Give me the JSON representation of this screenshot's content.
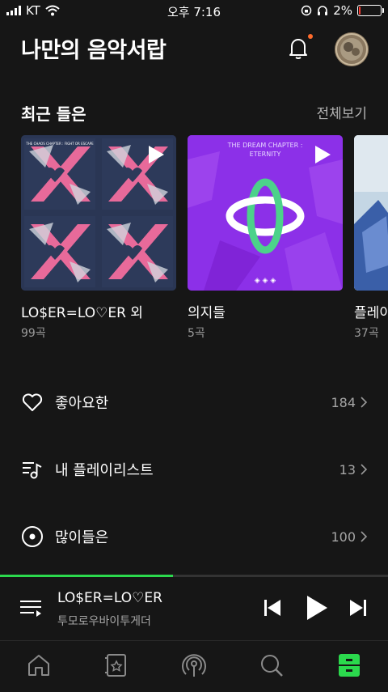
{
  "status": {
    "carrier": "KT",
    "time": "오후 7:16",
    "battery": "2%",
    "battery_level": 0.02
  },
  "header": {
    "title": "나만의 음악서랍",
    "bell_icon": "bell-icon",
    "avatar": "profile-avatar"
  },
  "recent": {
    "title": "최근 들은",
    "see_all": "전체보기",
    "cards": [
      {
        "title": "LO$ER=LO♡ER 외",
        "sub": "99곡",
        "cover_text": "THE CHAOS CHAPTER : FIGHT OR ESCAPE"
      },
      {
        "title": "의지들",
        "sub": "5곡",
        "cover_text_1": "THE DREAM CHAPTER :",
        "cover_text_2": "ETERNITY"
      },
      {
        "title": "플레이",
        "sub": "37곡"
      }
    ]
  },
  "library": [
    {
      "label": "좋아요한",
      "count": "184",
      "icon": "heart-icon"
    },
    {
      "label": "내 플레이리스트",
      "count": "13",
      "icon": "playlist-icon"
    },
    {
      "label": "많이들은",
      "count": "100",
      "icon": "disc-icon"
    }
  ],
  "player": {
    "title": "LO$ER=LO♡ER",
    "artist": "투모로우바이투게더",
    "progress": 0.445
  },
  "tabs": [
    "home-icon",
    "storage-icon",
    "podcast-icon",
    "search-icon",
    "my-library-icon"
  ],
  "colors": {
    "accent": "#2bd94d",
    "notification": "#ff6b2c",
    "background": "#161616"
  }
}
